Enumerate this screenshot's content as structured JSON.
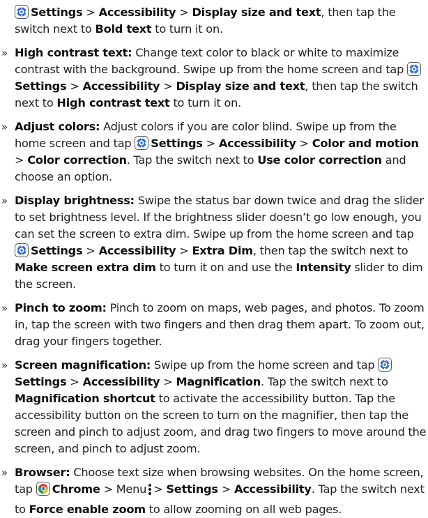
{
  "sep": ">",
  "icons": {
    "settings": "settings-gear-icon",
    "chrome": "chrome-icon",
    "menu": "menu-vertical-dots-icon"
  },
  "bold_text_cont": {
    "settings": "Settings",
    "accessibility": "Accessibility",
    "display_size": "Display size and text",
    "t1": ", then tap the switch next to ",
    "bold_text": "Bold text",
    "t2": " to turn it on."
  },
  "items": [
    {
      "title": "High contrast text:",
      "t1": " Change text color to black or white to maximize contrast with the background. Swipe up from the home screen and tap ",
      "settings": "Settings",
      "accessibility": "Accessibility",
      "display_size": "Display size and text",
      "t2": ", then tap the switch next to ",
      "option": "High contrast text",
      "t3": " to turn it on."
    },
    {
      "title": "Adjust colors:",
      "t1": " Adjust colors if you are color blind. Swipe up from the home screen and tap ",
      "settings": "Settings",
      "accessibility": "Accessibility",
      "color_motion": "Color and motion",
      "color_correction": "Color correction",
      "t2": ". Tap the switch next to ",
      "option": "Use color correction",
      "t3": " and choose an option."
    },
    {
      "title": "Display brightness:",
      "t1": " Swipe the status bar down twice and drag the slider to set brightness level. If the brightness slider doesn’t go low enough, you can set the screen to extra dim. Swipe up from the home screen and tap ",
      "settings": "Settings",
      "accessibility": "Accessibility",
      "extra_dim": "Extra Dim",
      "t2": ", then tap the switch next to ",
      "option": "Make screen extra dim",
      "t3": " to turn it on and use the ",
      "intensity": "Intensity",
      "t4": " slider to dim the screen."
    },
    {
      "title": "Pinch to zoom:",
      "t1": " Pinch to zoom on maps, web pages, and photos. To zoom in, tap the screen with two fingers and then drag them apart. To zoom out, drag your fingers together."
    },
    {
      "title": "Screen magnification:",
      "t1": " Swipe up from the home screen and tap ",
      "settings": "Settings",
      "accessibility": "Accessibility",
      "magnification": "Magnification",
      "t2": ". Tap the switch next to ",
      "option": "Magnification shortcut",
      "t3": " to activate the accessibility button. Tap the accessibility button on the screen to turn on the magnifier, then tap the screen and pinch to adjust zoom, and drag two fingers to move around the screen, and pinch to adjust zoom."
    },
    {
      "title": "Browser:",
      "t1": " Choose text size when browsing websites. On the home screen, tap ",
      "chrome": "Chrome",
      "menu": "Menu",
      "settings": "Settings",
      "accessibility": "Accessibility",
      "t2": ". Tap the switch next to ",
      "option": "Force enable zoom",
      "t3": " to allow zooming on all web pages."
    }
  ]
}
